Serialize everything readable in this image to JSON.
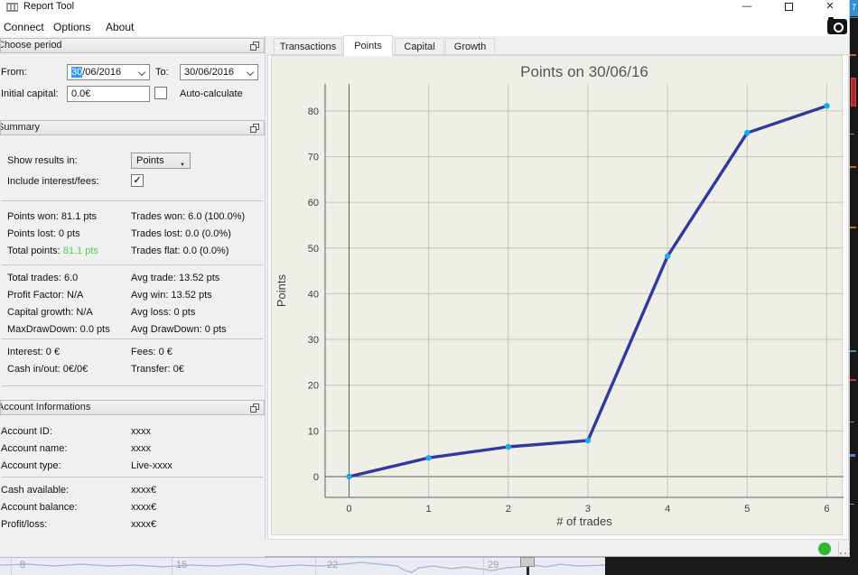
{
  "colors": {
    "selection": "#3297fd",
    "status_green": "#2db82d"
  },
  "icons": {
    "minimize": "—",
    "close": "✕",
    "checkmark": "✓",
    "dropdown_arrow": "▼"
  },
  "window": {
    "title": "Report Tool",
    "menu": [
      {
        "label": "Connect"
      },
      {
        "label": "Options"
      },
      {
        "label": "About"
      }
    ]
  },
  "period": {
    "header": "Choose period",
    "from_label": "From:",
    "from_value_selected": "30",
    "from_value_rest": "/06/2016",
    "to_label": "To:",
    "to_value": "30/06/2016",
    "initial_capital_label": "Initial capital:",
    "initial_capital_value": "0.0€",
    "auto_calculate_label": "Auto-calculate"
  },
  "summary": {
    "header": "Summary",
    "show_results_label": "Show results in:",
    "show_results_value": "Points",
    "include_interest_label": "Include interest/fees:",
    "total_points_color": "#4ad24a",
    "stats_points": [
      {
        "l": "Points won: 81.1 pts",
        "r": "Trades won: 6.0 (100.0%)"
      },
      {
        "l": "Points lost: 0 pts",
        "r": "Trades lost: 0.0 (0.0%)"
      },
      {
        "l_prefix": "Total points: ",
        "l_value": "81.1 pts",
        "r": "Trades flat: 0.0 (0.0%)"
      }
    ],
    "stats_trades": [
      {
        "l": "Total trades: 6.0",
        "r": "Avg trade: 13.52 pts"
      },
      {
        "l": "Profit Factor: N/A",
        "r": "Avg win: 13.52 pts"
      },
      {
        "l": "Capital growth: N/A",
        "r": "Avg loss: 0 pts"
      },
      {
        "l": "MaxDrawDown: 0.0 pts",
        "r": "Avg DrawDown: 0 pts"
      }
    ],
    "stats_cash": [
      {
        "l": "Interest: 0 €",
        "r": "Fees: 0 €"
      },
      {
        "l": "Cash in/out: 0€/0€",
        "r": "Transfer: 0€"
      }
    ]
  },
  "account": {
    "header": "Account Informations",
    "rows_top": [
      {
        "label": "Account ID:",
        "value": "xxxx"
      },
      {
        "label": "Account name:",
        "value": "xxxx"
      },
      {
        "label": "Account type:",
        "value": "Live-xxxx"
      }
    ],
    "rows_bottom": [
      {
        "label": "Cash available:",
        "value": "xxxx€"
      },
      {
        "label": "Account balance:",
        "value": "xxxx€"
      },
      {
        "label": "Profit/loss:",
        "value": "xxxx€"
      }
    ]
  },
  "tabs": [
    {
      "label": "Transactions",
      "active": false
    },
    {
      "label": "Points",
      "active": true
    },
    {
      "label": "Capital",
      "active": false
    },
    {
      "label": "Growth",
      "active": false
    }
  ],
  "chart_data": {
    "type": "line",
    "title": "Points on 30/06/16",
    "xlabel": "# of trades",
    "ylabel": "Points",
    "x": [
      0,
      1,
      2,
      3,
      4,
      5,
      6
    ],
    "series": [
      {
        "name": "Points",
        "values": [
          0,
          4.1,
          6.5,
          7.9,
          48.2,
          75.2,
          81.1
        ]
      }
    ],
    "xticks": [
      0,
      1,
      2,
      3,
      4,
      5,
      6
    ],
    "yticks": [
      0,
      10,
      20,
      30,
      40,
      50,
      60,
      70,
      80
    ],
    "xlim": [
      -0.3,
      6.21
    ],
    "ylim": [
      -4.55,
      85.9
    ],
    "grid": true,
    "legend": false,
    "bg_color": "#f0efe7",
    "grid_color": "#c6c6be",
    "axis_color": "#5f5f5f",
    "line_color": "#2e3a9e",
    "marker_color": "#18aaee",
    "tick_color": "#3d3d3d",
    "title_color": "#555555"
  },
  "background": {
    "bottom_axis_labels": [
      "8",
      "15",
      "22",
      "29"
    ],
    "right_badge": "7"
  }
}
